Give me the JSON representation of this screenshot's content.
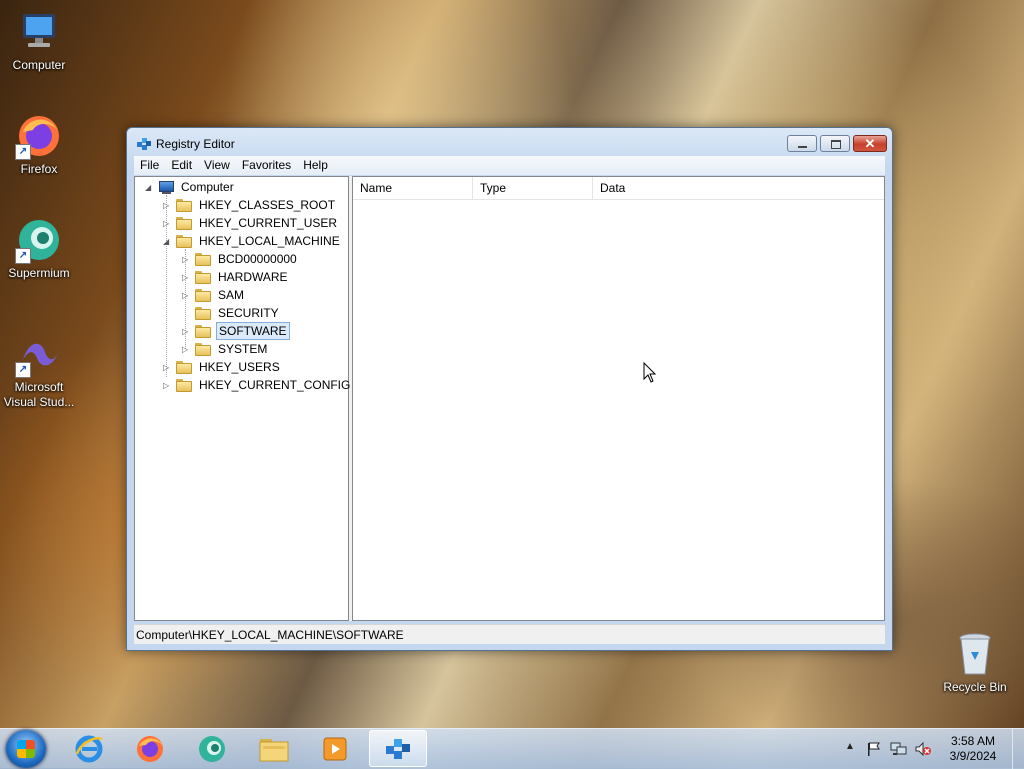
{
  "desktop": {
    "icons": [
      {
        "label": "Computer",
        "icon": "computer-icon"
      },
      {
        "label": "Firefox",
        "icon": "firefox-icon"
      },
      {
        "label": "Supermium",
        "icon": "supermium-icon"
      },
      {
        "label": "Microsoft Visual Stud...",
        "icon": "visual-studio-icon"
      },
      {
        "label": "Recycle Bin",
        "icon": "recycle-bin-icon"
      }
    ]
  },
  "window": {
    "title": "Registry Editor",
    "close_glyph": "✕",
    "menu": [
      "File",
      "Edit",
      "View",
      "Favorites",
      "Help"
    ],
    "tree": {
      "root": "Computer",
      "hives": [
        "HKEY_CLASSES_ROOT",
        "HKEY_CURRENT_USER",
        "HKEY_LOCAL_MACHINE",
        "HKEY_USERS",
        "HKEY_CURRENT_CONFIG"
      ],
      "hklm_children": [
        "BCD00000000",
        "HARDWARE",
        "SAM",
        "SECURITY",
        "SOFTWARE",
        "SYSTEM"
      ],
      "selected": "SOFTWARE"
    },
    "columns": [
      "Name",
      "Type",
      "Data"
    ],
    "status": "Computer\\HKEY_LOCAL_MACHINE\\SOFTWARE"
  },
  "taskbar": {
    "apps": [
      "internet-explorer-icon",
      "firefox-icon",
      "supermium-icon",
      "file-explorer-icon",
      "media-player-icon",
      "registry-editor-icon"
    ],
    "active_app": "registry-editor-icon",
    "tray_icons": [
      "show-hidden-icons-icon",
      "action-center-flag-icon",
      "network-icon",
      "volume-muted-icon"
    ],
    "time": "3:58 AM",
    "date": "3/9/2024"
  },
  "colors": {
    "selection": "#dbeaf8",
    "accent": "#1d6bc0",
    "close_button": "#c6412d"
  }
}
